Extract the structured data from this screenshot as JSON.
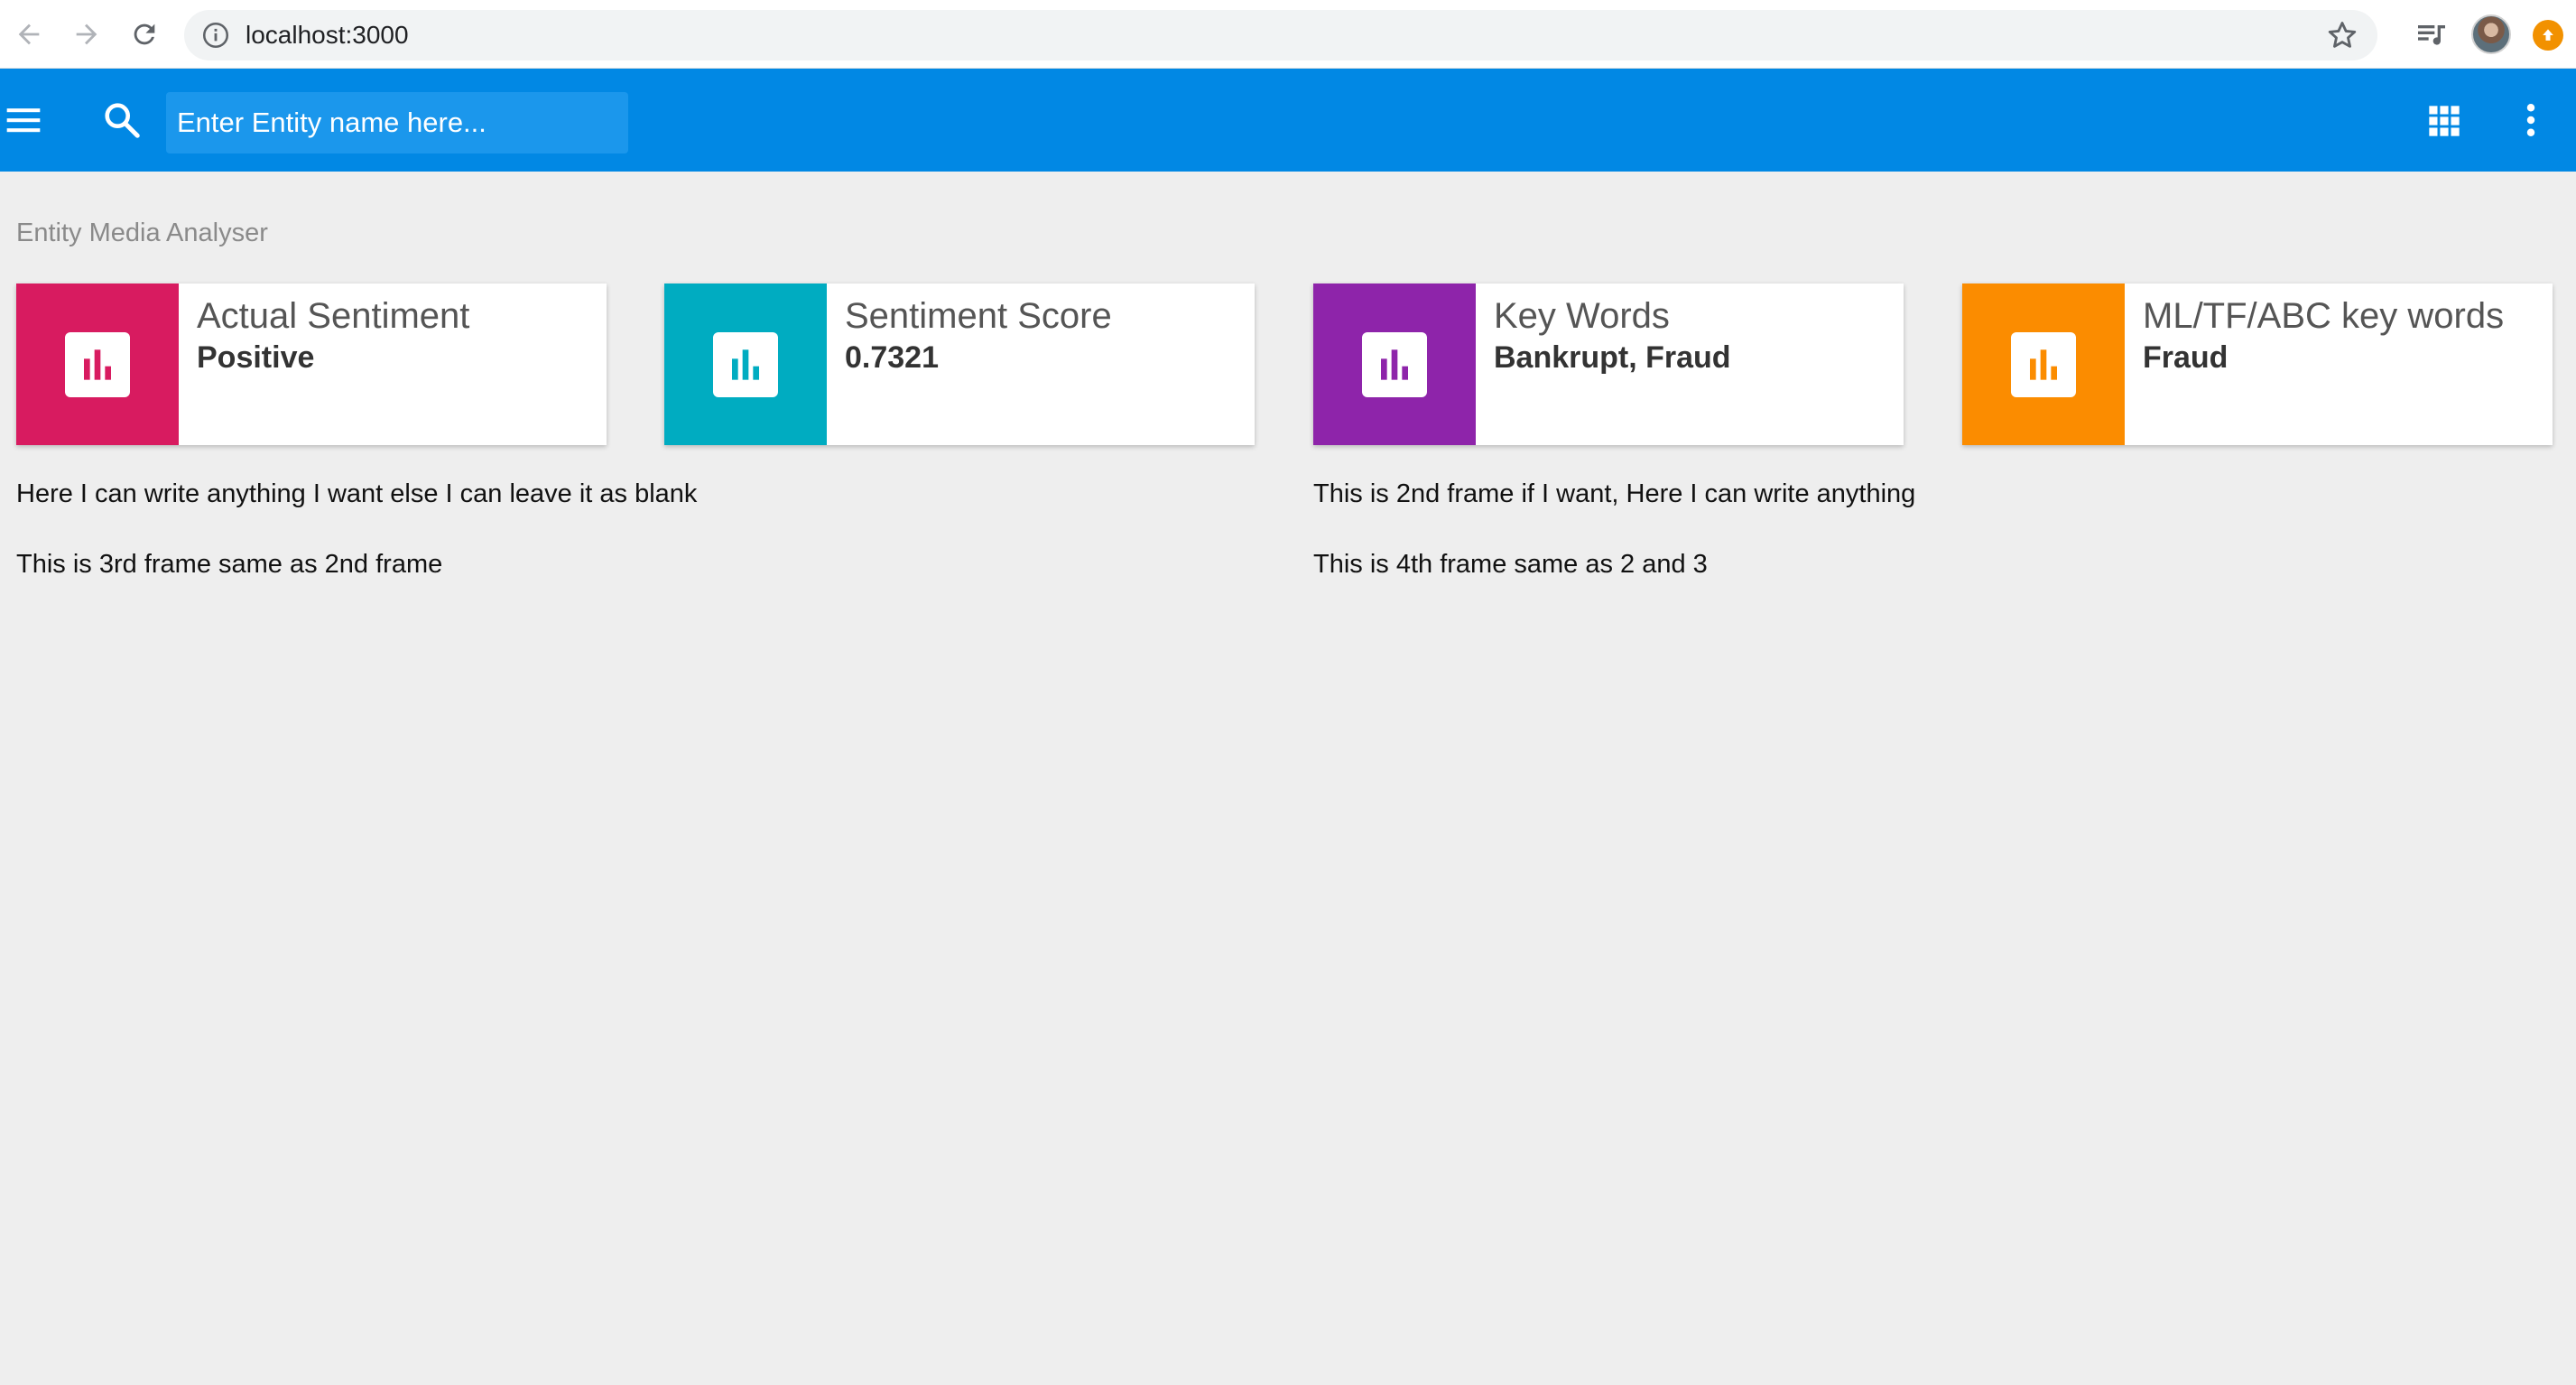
{
  "browser": {
    "url": "localhost:3000"
  },
  "appbar": {
    "search_placeholder": "Enter Entity name here..."
  },
  "page": {
    "title": "Entity Media Analyser"
  },
  "cards": [
    {
      "title": "Actual Sentiment",
      "value": "Positive",
      "color": "#d81b60"
    },
    {
      "title": "Sentiment Score",
      "value": "0.7321",
      "color": "#00acc1"
    },
    {
      "title": "Key Words",
      "value": "Bankrupt, Fraud",
      "color": "#8e24aa"
    },
    {
      "title": "ML/TF/ABC key words",
      "value": "Fraud",
      "color": "#fb8c00"
    }
  ],
  "notes": {
    "frame1": "Here I can write anything I want else I can leave it as blank",
    "frame2": "This is 2nd frame if I want, Here I can write anything",
    "frame3": "This is 3rd frame same as 2nd frame",
    "frame4": "This is 4th frame same as 2 and 3"
  },
  "colors": {
    "appbar": "#0188e4",
    "background": "#eeeeee"
  }
}
